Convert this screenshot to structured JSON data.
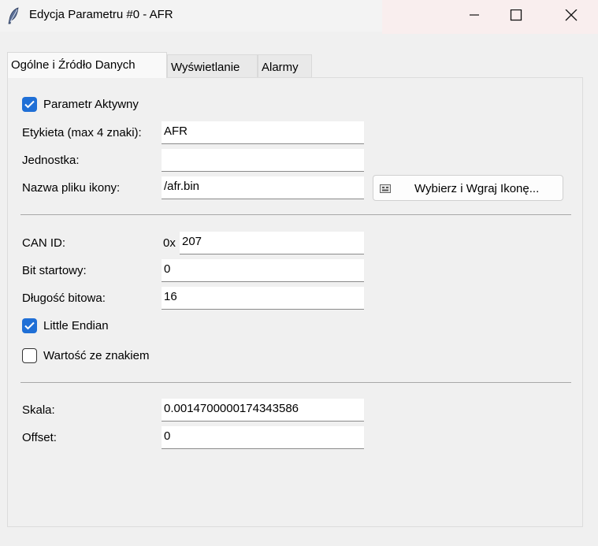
{
  "window": {
    "title": "Edycja Parametru #0 - AFR",
    "icon": "feather-icon"
  },
  "tabs": [
    {
      "label": "Ogólne i Źródło Danych",
      "active": true
    },
    {
      "label": "Wyświetlanie",
      "active": false
    },
    {
      "label": "Alarmy",
      "active": false
    }
  ],
  "general": {
    "active_checkbox": {
      "label": "Parametr Aktywny",
      "checked": true
    },
    "label_field": {
      "label": "Etykieta (max 4 znaki):",
      "value": "AFR"
    },
    "unit_field": {
      "label": "Jednostka:",
      "value": ""
    },
    "icon_file_field": {
      "label": "Nazwa pliku ikony:",
      "value": "/afr.bin"
    },
    "choose_icon_button": {
      "label": "Wybierz i Wgraj Ikonę...",
      "icon": "image-icon"
    }
  },
  "source": {
    "can_id": {
      "label": "CAN ID:",
      "prefix": "0x",
      "value": "207"
    },
    "start_bit": {
      "label": "Bit startowy:",
      "value": "0"
    },
    "bit_length": {
      "label": "Długość bitowa:",
      "value": "16"
    },
    "little_endian": {
      "label": "Little Endian",
      "checked": true
    },
    "signed": {
      "label": "Wartość ze znakiem",
      "checked": false
    }
  },
  "scaling": {
    "scale": {
      "label": "Skala:",
      "value": "0.0014700000174343586"
    },
    "offset": {
      "label": "Offset:",
      "value": "0"
    }
  },
  "colors": {
    "checkbox_accent": "#1f6fd6",
    "window_bg": "#f0f0f0"
  }
}
